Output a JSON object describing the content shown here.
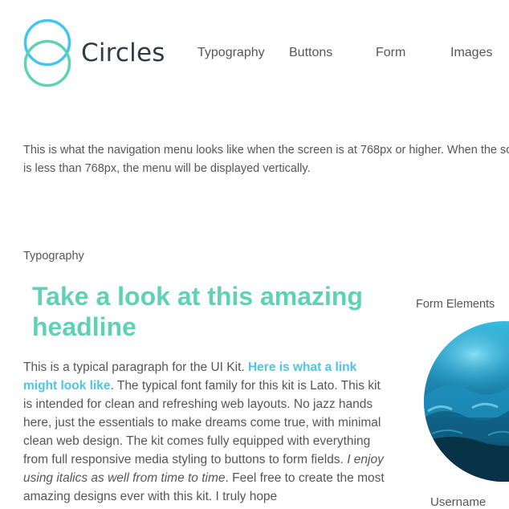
{
  "header": {
    "logo_text": "Circles",
    "nav": [
      {
        "label": "Typography"
      },
      {
        "label": "Buttons"
      },
      {
        "label": "Form"
      },
      {
        "label": "Images"
      }
    ]
  },
  "intro": {
    "line1": "This is what the navigation menu looks like when the screen is at 768px or higher. When the screen",
    "line2": "is less than 768px, the menu will be displayed vertically."
  },
  "typography": {
    "section_label": "Typography",
    "headline": "Take a look at this amazing headline",
    "paragraph": {
      "text1": "This is a typical paragraph for the UI Kit. ",
      "link": "Here is what a link might look like",
      "text2": ". The typical font family for this kit is Lato. This kit is intended for clean and refreshing web layouts. No jazz hands here, just the essentials to make dreams come true, with minimal clean web design. The kit comes fully equipped with everything from full responsive media styling to buttons to form fields. ",
      "italic": "I enjoy using italics as well from time to time",
      "text3": ". Feel free to create the most amazing designs ever with this kit. I truly hope"
    }
  },
  "form": {
    "section_label": "Form Elements",
    "username_label": "Username"
  },
  "colors": {
    "logo_teal": "#5fd2b5",
    "logo_blue": "#3fc7ee",
    "headline": "#5fd2b5",
    "link": "#4fc4e6",
    "text": "#555555",
    "logo_text": "#2f3e46"
  },
  "icons": {
    "logo": "circles-logo-icon",
    "image": "ocean-wave-image"
  }
}
